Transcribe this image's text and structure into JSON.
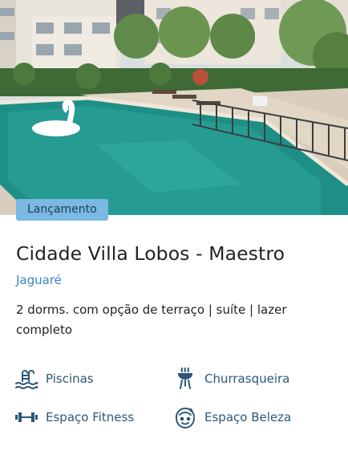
{
  "badge": "Lançamento",
  "title": "Cidade Villa Lobos - Maestro",
  "region": "Jaguaré",
  "description": "2 dorms. com opção de terraço | suíte | lazer completo",
  "amenities": [
    {
      "label": "Piscinas",
      "icon": "pool-ladder-icon"
    },
    {
      "label": "Churrasqueira",
      "icon": "barbecue-grill-icon"
    },
    {
      "label": "Espaço Fitness",
      "icon": "dumbbell-icon"
    },
    {
      "label": "Espaço Beleza",
      "icon": "beauty-face-icon"
    }
  ],
  "colors": {
    "badge_bg": "#79b9e2",
    "title": "#222222",
    "region": "#3b86c4",
    "amenity": "#2c5878"
  }
}
